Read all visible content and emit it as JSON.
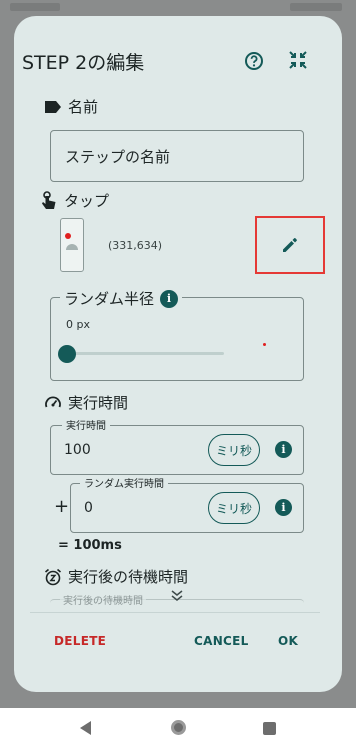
{
  "dialog": {
    "title": "STEP 2の編集",
    "help_icon": "help-circle-icon",
    "collapse_icon": "collapse-arrows-icon"
  },
  "name_section": {
    "label": "名前",
    "icon": "label-tag-icon",
    "field_value": "ステップの名前"
  },
  "tap_section": {
    "label": "タップ",
    "icon": "touch-hand-icon",
    "coordinates": "(331,634)",
    "edit_icon": "pencil-edit-icon",
    "highlight_color": "#e53935"
  },
  "random_radius": {
    "label": "ランダム半径",
    "value": "0 px",
    "slider_fraction": 0
  },
  "exec_time": {
    "section_label": "実行時間",
    "icon": "speedometer-icon",
    "field_label": "実行時間",
    "value": "100",
    "unit": "ミリ秒",
    "random_label": "ランダム実行時間",
    "random_value": "0",
    "random_unit": "ミリ秒",
    "plus_sign": "+",
    "total": "=  100ms"
  },
  "wait_time": {
    "section_label": "実行後の待機時間",
    "icon": "alarm-snooze-icon",
    "field_label_partial": "実行後の待機時間"
  },
  "actions": {
    "delete": "DELETE",
    "cancel": "CANCEL",
    "ok": "OK"
  },
  "colors": {
    "accent": "#145a58",
    "danger": "#c62828",
    "dialog_bg": "#dfe9e8"
  }
}
